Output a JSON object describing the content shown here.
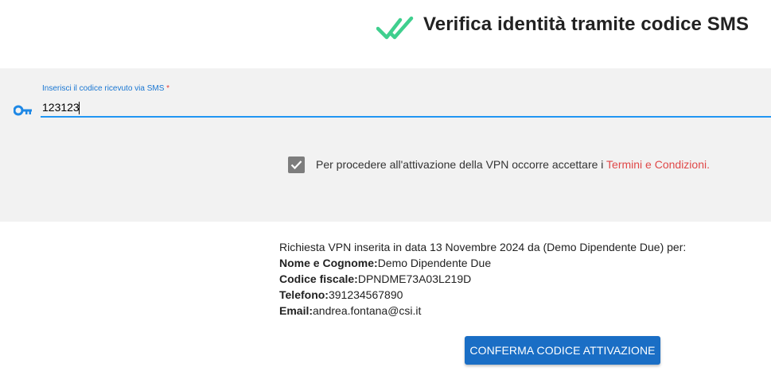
{
  "header": {
    "title": "Verifica identità tramite codice SMS",
    "icon": "double-check-icon",
    "icon_color": "#3fcf8e"
  },
  "sms_field": {
    "label": "Inserisci il codice ricevuto via SMS",
    "required_mark": "*",
    "value": "123123",
    "icon": "key-icon",
    "accent_color": "#2196f3"
  },
  "terms": {
    "checked": true,
    "text": "Per procedere all'attivazione della VPN occorre accettare i ",
    "link_label": "Termini e Condizioni.",
    "link_color": "#e04848"
  },
  "request_info": {
    "intro": "Richiesta VPN inserita in data 13 Novembre 2024 da (Demo Dipendente Due) per:",
    "name_label": "Nome e Cognome:",
    "name_value": "Demo Dipendente Due",
    "fiscal_label": "Codice fiscale:",
    "fiscal_value": "DPNDME73A03L219D",
    "phone_label": "Telefono:",
    "phone_value": "391234567890",
    "email_label": "Email:",
    "email_value": "andrea.fontana@csi.it"
  },
  "actions": {
    "confirm_label": "CONFERMA CODICE ATTIVAZIONE",
    "confirm_color": "#1a6ec5"
  }
}
